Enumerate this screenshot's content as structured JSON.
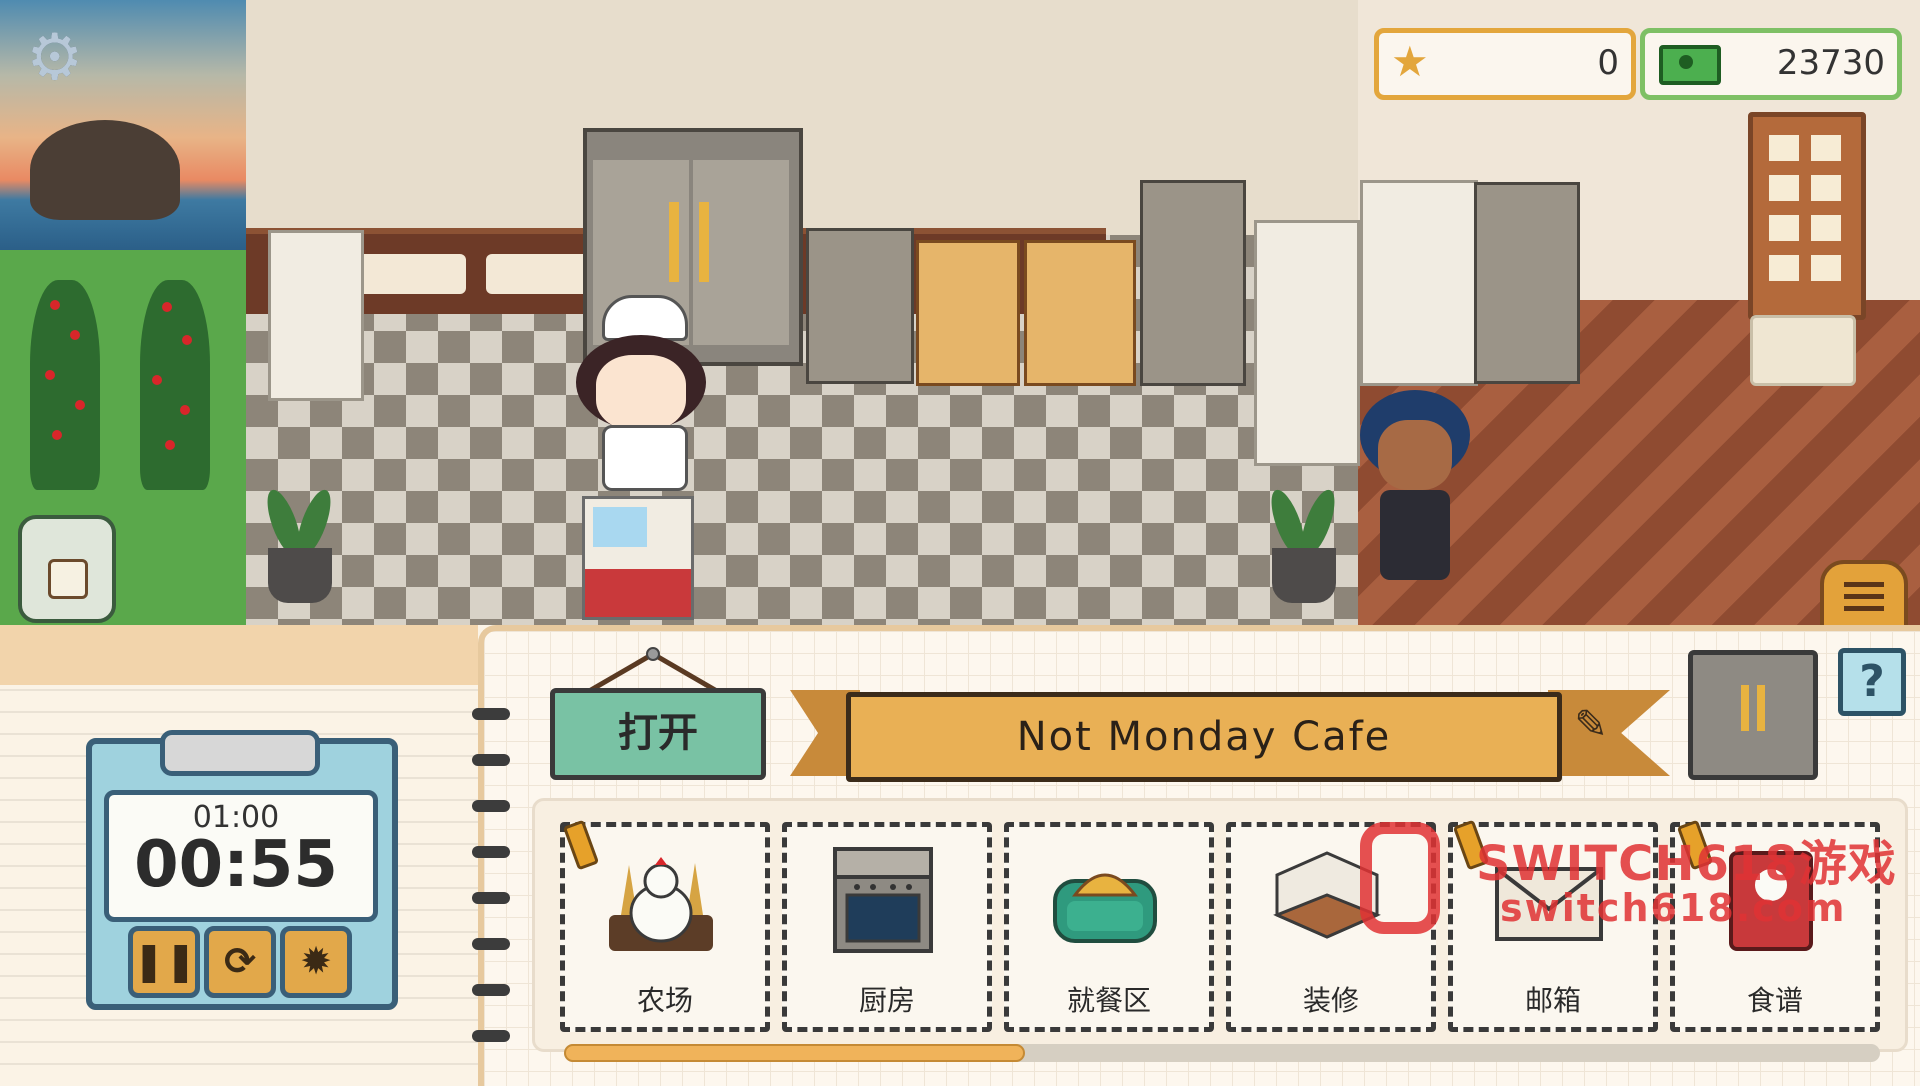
{
  "hud": {
    "settings_icon": "gear-icon",
    "stars": {
      "icon": "star-icon",
      "value": "0"
    },
    "money": {
      "icon": "cash-icon",
      "value": "23730"
    },
    "menu_icon": "hamburger-menu-icon"
  },
  "timer": {
    "total": "01:00",
    "current": "00:55",
    "buttons": [
      {
        "icon": "pause-icon",
        "glyph": "❚❚"
      },
      {
        "icon": "restart-icon",
        "glyph": "⟳"
      },
      {
        "icon": "settings-icon",
        "glyph": "✹"
      }
    ]
  },
  "shop": {
    "open_sign": "打开",
    "name": "Not Monday Cafe",
    "edit_icon": "pencil-icon",
    "fridge_icon": "fridge-icon",
    "help_label": "?"
  },
  "tiles": [
    {
      "label": "农场",
      "icon": "farm-chicken-icon",
      "alert": true
    },
    {
      "label": "厨房",
      "icon": "stove-icon",
      "alert": false
    },
    {
      "label": "就餐区",
      "icon": "sofa-icon",
      "alert": false
    },
    {
      "label": "装修",
      "icon": "room-decor-icon",
      "alert": false
    },
    {
      "label": "邮箱",
      "icon": "mail-envelope-icon",
      "alert": true
    },
    {
      "label": "食谱",
      "icon": "recipe-book-icon",
      "alert": true
    }
  ],
  "progress": {
    "fraction": 0.35
  },
  "watermark": {
    "line1": "SWITCH618游戏",
    "line2": "switch618.com"
  },
  "colors": {
    "accent": "#e9b055",
    "open_sign": "#79c2a4",
    "money_border": "#7ec065",
    "stars_border": "#e3a63c"
  }
}
